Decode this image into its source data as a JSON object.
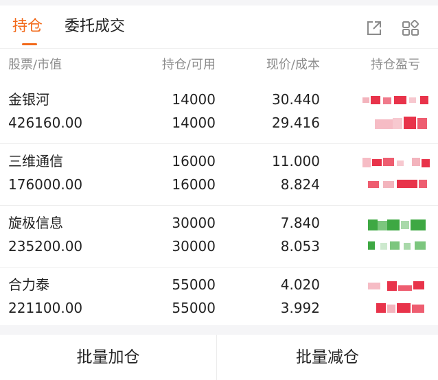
{
  "tabs": {
    "active_label": "持仓",
    "other_label": "委托成交"
  },
  "icons": {
    "share": "share-icon",
    "grid": "grid-icon"
  },
  "colors": {
    "accent": "#f26a1b",
    "profit": "#e8334a",
    "loss": "#3ea843"
  },
  "table": {
    "columns": {
      "stock": "股票/市值",
      "position": "持仓/可用",
      "price": "现价/成本",
      "pnl": "持仓盈亏"
    },
    "rows": [
      {
        "name": "金银河",
        "market_value": "426160.00",
        "position": "14000",
        "available": "14000",
        "price": "30.440",
        "cost": "29.416",
        "pnl_tone": "profit"
      },
      {
        "name": "三维通信",
        "market_value": "176000.00",
        "position": "16000",
        "available": "16000",
        "price": "11.000",
        "cost": "8.824",
        "pnl_tone": "profit"
      },
      {
        "name": "旋极信息",
        "market_value": "235200.00",
        "position": "30000",
        "available": "30000",
        "price": "7.840",
        "cost": "8.053",
        "pnl_tone": "loss"
      },
      {
        "name": "合力泰",
        "market_value": "221100.00",
        "position": "55000",
        "available": "55000",
        "price": "4.020",
        "cost": "3.992",
        "pnl_tone": "profit"
      }
    ]
  },
  "actions": {
    "batch_add": "批量加仓",
    "batch_reduce": "批量减仓"
  }
}
